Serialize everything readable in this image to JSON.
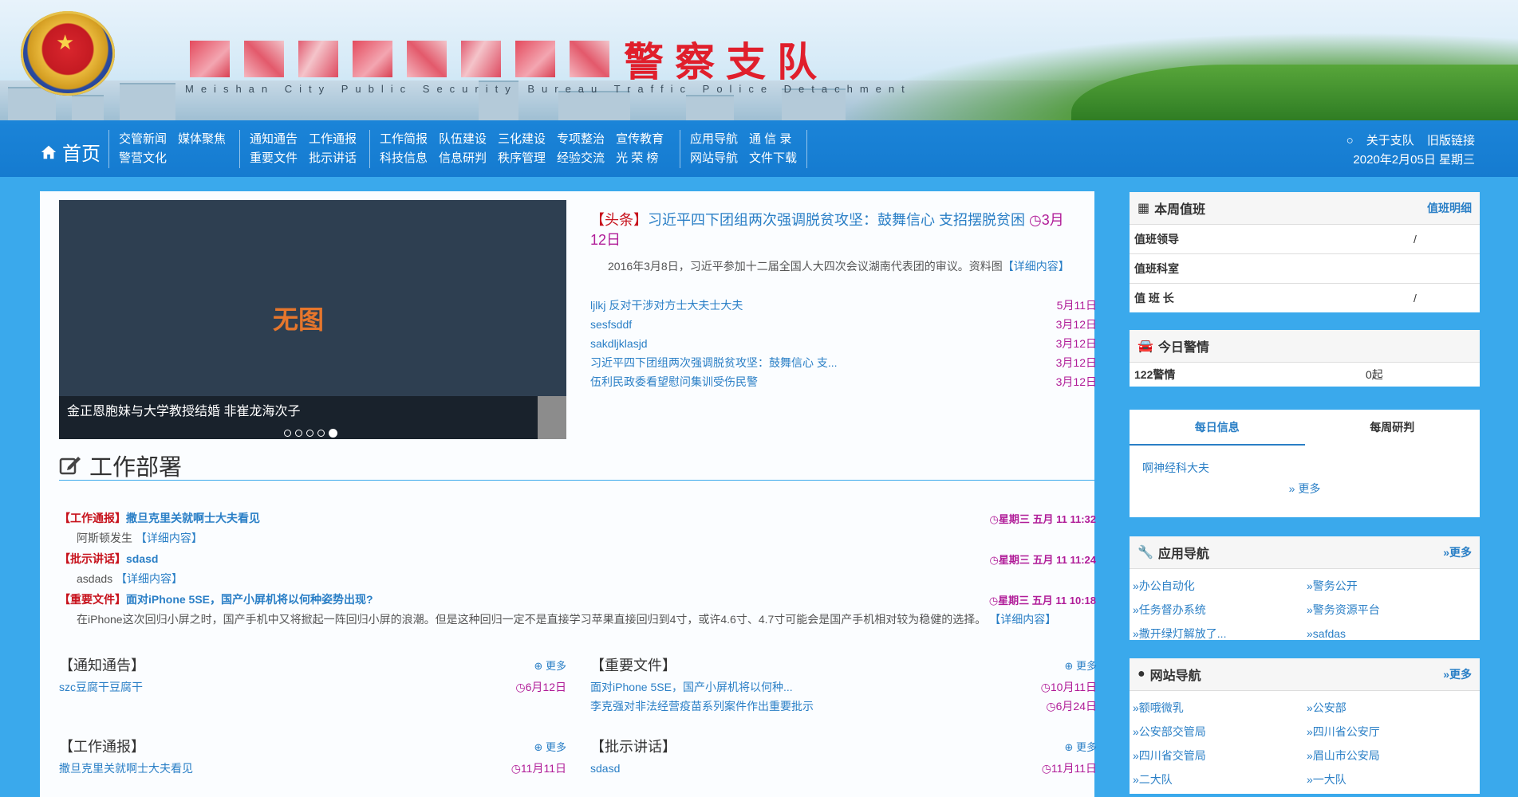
{
  "banner": {
    "title_visible": "警察支队",
    "subtitle": "Meishan City Public Security Bureau Traffic Police Detachment"
  },
  "nav": {
    "home": "首页",
    "groups": [
      [
        "交管新闻",
        "警营文化",
        "媒体聚焦"
      ],
      [
        "通知通告",
        "重要文件",
        "工作通报",
        "批示讲话"
      ],
      [
        "工作简报",
        "科技信息",
        "队伍建设",
        "信息研判",
        "三化建设",
        "秩序管理",
        "专项整治",
        "经验交流",
        "宣传教育",
        "光 荣 榜"
      ],
      [
        "应用导航",
        "网站导航",
        "通 信 录",
        "文件下载"
      ]
    ],
    "about": "关于支队",
    "old_link": "旧版链接",
    "date": "2020年2月05日 星期三"
  },
  "slider": {
    "noimg": "无图",
    "caption": "金正恩胞妹与大学教授结婚 非崔龙海次子"
  },
  "headline": {
    "tag": "【头条】",
    "title": "习近平四下团组两次强调脱贫攻坚：鼓舞信心 支招摆脱贫困",
    "date": "3月12日",
    "desc": "2016年3月8日，习近平参加十二届全国人大四次会议湖南代表团的审议。资料图",
    "more": "【详细内容】"
  },
  "news": [
    {
      "t": "ljlkj 反对干涉对方士大夫士大夫",
      "d": "5月11日"
    },
    {
      "t": "sesfsddf",
      "d": "3月12日"
    },
    {
      "t": "sakdljklasjd",
      "d": "3月12日"
    },
    {
      "t": "习近平四下团组两次强调脱贫攻坚：鼓舞信心 支...",
      "d": "3月12日"
    },
    {
      "t": "伍利民政委看望慰问集训受伤民警",
      "d": "3月12日"
    }
  ],
  "deploy": {
    "title": "工作部署",
    "items": [
      {
        "tag": "【工作通报】",
        "title": "撒旦克里关就啊士大夫看见",
        "time": "星期三 五月 11 11:32",
        "desc": "阿斯顿发生",
        "more": "【详细内容】"
      },
      {
        "tag": "【批示讲话】",
        "title": "sdasd",
        "time": "星期三 五月 11 11:24",
        "desc": "asdads",
        "more": "【详细内容】"
      },
      {
        "tag": "【重要文件】",
        "title": "面对iPhone 5SE，国产小屏机将以何种姿势出现?",
        "time": "星期三 五月 11 10:18",
        "desc": "在iPhone这次回归小屏之时，国产手机中又将掀起一阵回归小屏的浪潮。但是这种回归一定不是直接学习苹果直接回归到4寸，或许4.6寸、4.7寸可能会是国产手机相对较为稳健的选择。",
        "more": "【详细内容】"
      }
    ]
  },
  "boxes": [
    {
      "title": "【通知通告】",
      "more": "更多",
      "rows": [
        {
          "t": "szc豆腐干豆腐干",
          "d": "6月12日"
        }
      ]
    },
    {
      "title": "【重要文件】",
      "more": "更多",
      "rows": [
        {
          "t": "面对iPhone 5SE，国产小屏机将以何种...",
          "d": "10月11日"
        },
        {
          "t": "李克强对非法经营疫苗系列案件作出重要批示",
          "d": "6月24日"
        }
      ]
    },
    {
      "title": "【工作通报】",
      "more": "更多",
      "rows": [
        {
          "t": "撒旦克里关就啊士大夫看见",
          "d": "11月11日"
        }
      ]
    },
    {
      "title": "【批示讲话】",
      "more": "更多",
      "rows": [
        {
          "t": "sdasd",
          "d": "11月11日"
        }
      ]
    }
  ],
  "duty": {
    "title": "本周值班",
    "link": "值班明细",
    "rows": [
      {
        "k": "值班领导",
        "v": "/"
      },
      {
        "k": "值班科室",
        "v": ""
      },
      {
        "k": "值 班 长",
        "v": "/"
      }
    ]
  },
  "police": {
    "title": "今日警情",
    "rows": [
      {
        "k": "122警情",
        "v": "0起"
      }
    ]
  },
  "info": {
    "tabs": [
      "每日信息",
      "每周研判"
    ],
    "item": "啊神经科大夫",
    "more": "» 更多"
  },
  "apps": {
    "title": "应用导航",
    "more": "»更多",
    "items": [
      "»办公自动化",
      "»警务公开",
      "»任务督办系统",
      "»警务资源平台",
      "»撒开绿灯解放了...",
      "»safdas"
    ]
  },
  "sites": {
    "title": "网站导航",
    "more": "»更多",
    "items": [
      "»额哦微乳",
      "»公安部",
      "»公安部交管局",
      "»四川省公安厅",
      "»四川省交管局",
      "»眉山市公安局",
      "»二大队",
      "»一大队"
    ]
  }
}
